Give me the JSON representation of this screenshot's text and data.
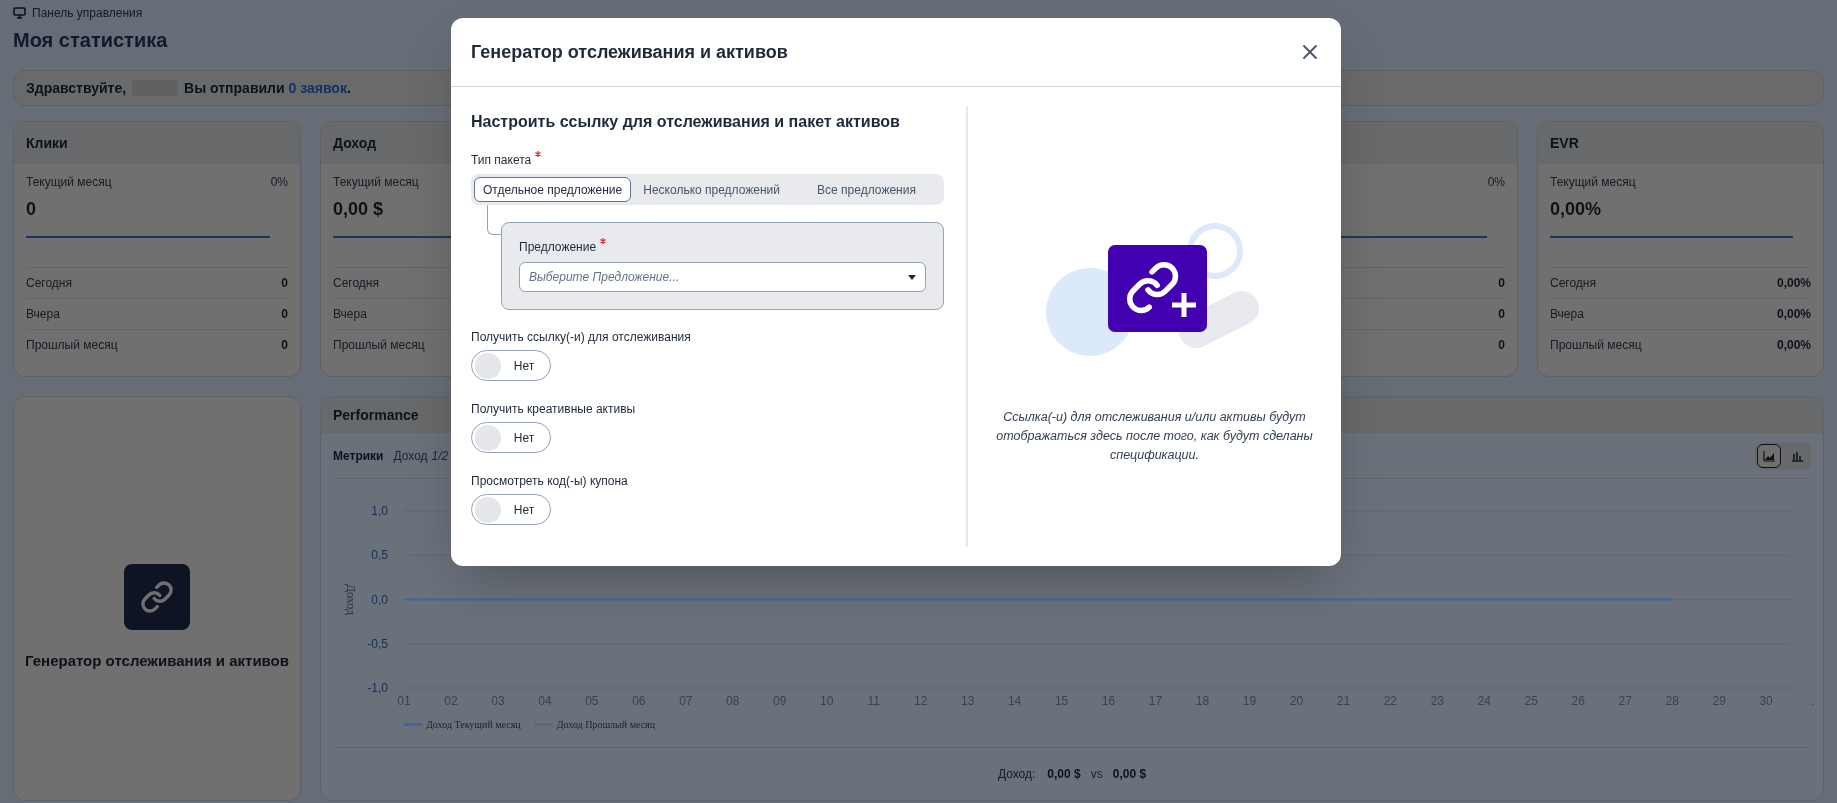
{
  "breadcrumb": "Панель управления",
  "page_title": "Моя статистика",
  "greeting": {
    "salutation": "Здравствуйте,",
    "text": "Вы отправили",
    "link": "0 заявок",
    "end": "."
  },
  "stat_cards": [
    {
      "title": "Клики",
      "current_label": "Текущий месяц",
      "change": "0%",
      "value": "0",
      "rows": [
        {
          "label": "Сегодня",
          "value": "0"
        },
        {
          "label": "Вчера",
          "value": "0"
        },
        {
          "label": "Прошлый месяц",
          "value": "0"
        }
      ]
    },
    {
      "title": "Доход",
      "current_label": "Текущий месяц",
      "value": "0,00 $",
      "rows": [
        {
          "label": "Сегодня"
        },
        {
          "label": "Вчера"
        },
        {
          "label": "Прошлый месяц"
        }
      ]
    },
    {
      "change": "0%",
      "rows": [
        {
          "value": "0"
        },
        {
          "value": "0"
        },
        {
          "value": "0"
        }
      ]
    },
    {
      "title": "EVR",
      "current_label": "Текущий месяц",
      "value": "0,00%",
      "rows": [
        {
          "label": "Сегодня",
          "value": "0,00%"
        },
        {
          "label": "Вчера",
          "value": "0,00%"
        },
        {
          "label": "Прошлый месяц",
          "value": "0,00%"
        }
      ]
    }
  ],
  "tracking_card": {
    "title": "Генератор отслеживания и активов"
  },
  "performance": {
    "title": "Performance",
    "metrics_label": "Метрики",
    "metric": "Доход",
    "page": "1/2",
    "view_buttons": [
      {
        "kind": "area",
        "selected": true
      },
      {
        "kind": "bar",
        "selected": false
      }
    ],
    "chart_data": {
      "type": "line",
      "ylabel": "Доход",
      "categories": [
        "01",
        "02",
        "03",
        "04",
        "05",
        "06",
        "07",
        "08",
        "09",
        "10",
        "11",
        "12",
        "13",
        "14",
        "15",
        "16",
        "17",
        "18",
        "19",
        "20",
        "21",
        "22",
        "23",
        "24",
        "25",
        "26",
        "27",
        "28",
        "29",
        "30",
        "."
      ],
      "series": [
        {
          "name": "Доход Текущий месяц",
          "color": "#3d66a3",
          "values": [
            0,
            0,
            0,
            0,
            0,
            0,
            0,
            0,
            0,
            0,
            0,
            0,
            0,
            0,
            0,
            0,
            0,
            0,
            0,
            0,
            0,
            0,
            0,
            0,
            0,
            0,
            0,
            0,
            null,
            null,
            null
          ]
        },
        {
          "name": "Доход Прошлый месяц",
          "color": "#58677c",
          "values": [
            null,
            null,
            null,
            null,
            null,
            null,
            null,
            null,
            null,
            null,
            null,
            null,
            null,
            null,
            null,
            null,
            null,
            null,
            null,
            null,
            null,
            null,
            null,
            null,
            null,
            null,
            null,
            null,
            null,
            null,
            null
          ]
        }
      ],
      "ylim": [
        -1,
        1
      ],
      "grid": true,
      "yticks": [
        {
          "value": 1,
          "label": "1,0"
        },
        {
          "value": 0.5,
          "label": "0,5"
        },
        {
          "value": 0,
          "label": "0,0"
        },
        {
          "value": -0.5,
          "label": "-0,5"
        },
        {
          "value": -1,
          "label": "-1,0"
        }
      ]
    },
    "footer": {
      "label": "Доход:",
      "current": "0,00 $",
      "vs": "vs",
      "previous": "0,00 $"
    }
  },
  "modal": {
    "title": "Генератор отслеживания и активов",
    "heading": "Настроить ссылку для отслеживания и пакет активов",
    "package_type": {
      "label": "Тип пакета",
      "required": true,
      "options": [
        {
          "label": "Отдельное предложение",
          "selected": true
        },
        {
          "label": "Несколько предложений",
          "selected": false
        },
        {
          "label": "Все предложения",
          "selected": false
        }
      ]
    },
    "offer": {
      "label": "Предложение",
      "required": true,
      "placeholder": "Выберите Предложение..."
    },
    "toggles": [
      {
        "label": "Получить ссылку(-и) для отслеживания",
        "on": false,
        "text": "Нет"
      },
      {
        "label": "Получить креативные активы",
        "on": false,
        "text": "Нет"
      },
      {
        "label": "Просмотреть код(-ы) купона",
        "on": false,
        "text": "Нет"
      }
    ],
    "preview_text": "Ссылка(-и) для отслеживания и/или активы будут отображаться здесь после того, как будут сделаны спецификации."
  }
}
